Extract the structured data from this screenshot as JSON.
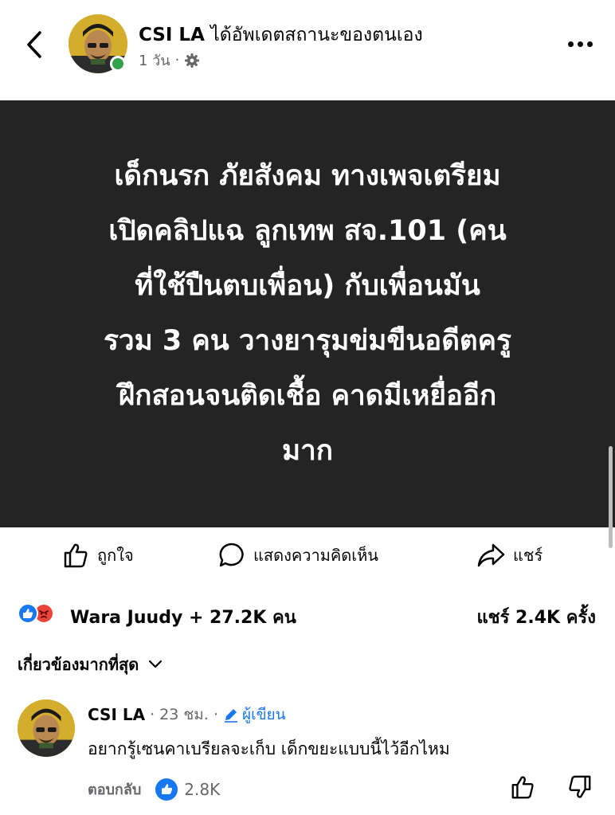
{
  "header": {
    "author": "CSI LA",
    "action": "ได้อัพเดตสถานะของตนเอง",
    "time": "1 วัน",
    "separator": "·"
  },
  "post": {
    "banner_text": "เด็กนรก ภัยสังคม ทางเพจเตรียม\nเปิดคลิปแฉ ลูกเทพ สจ.101 (คน\nที่ใช้ปืนตบเพื่อน) กับเพื่อนมัน\nรวม 3 คน วางยารุมข่มขืนอดีตครู\nฝึกสอนจนติดเชื้อ คาดมีเหยื่ออีก\nมาก"
  },
  "actions": {
    "like_label": "ถูกใจ",
    "comment_label": "แสดงความคิดเห็น",
    "share_label": "แชร์"
  },
  "stats": {
    "reactors": "Wara Juudy + 27.2K คน",
    "shares": "แชร์ 2.4K ครั้ง"
  },
  "sort": {
    "label": "เกี่ยวข้องมากที่สุด"
  },
  "comment": {
    "name": "CSI LA",
    "time": "· 23 ชม. ·",
    "author_tag": "ผู้เขียน",
    "text": "อยากรู้เซนคาเบรียลจะเก็บ เด็กขยะแบบนี้ไว้อีกไหม",
    "reply_label": "ตอบกลับ",
    "like_count": "2.8K"
  },
  "colors": {
    "accent": "#1877f2",
    "online": "#31a24c",
    "angry": "#e9443a",
    "banner_bg": "#242424",
    "meta": "#65676b"
  }
}
